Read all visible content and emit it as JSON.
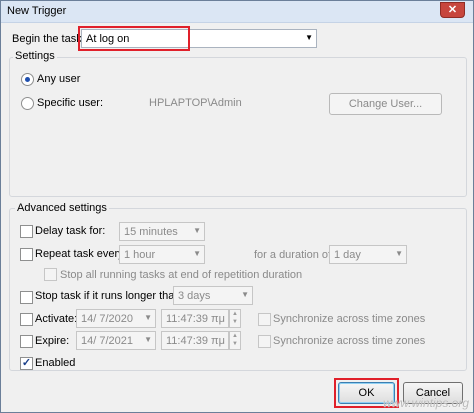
{
  "window": {
    "title": "New Trigger",
    "close_glyph": "✕"
  },
  "begin_task": {
    "label": "Begin the task:",
    "value": "At log on"
  },
  "settings": {
    "group_label": "Settings",
    "any_user_label": "Any user",
    "specific_user_label": "Specific user:",
    "user_value": "HPLAPTOP\\Admin",
    "change_user_label": "Change User..."
  },
  "advanced": {
    "group_label": "Advanced settings",
    "delay_label": "Delay task for:",
    "delay_value": "15 minutes",
    "repeat_label": "Repeat task every:",
    "repeat_value": "1 hour",
    "duration_label": "for a duration of:",
    "duration_value": "1 day",
    "stop_running_label": "Stop all running tasks at end of repetition duration",
    "stop_longer_label": "Stop task if it runs longer than:",
    "stop_longer_value": "3 days",
    "activate_label": "Activate:",
    "activate_date": "14/ 7/2020",
    "activate_time": "11:47:39 πμ",
    "expire_label": "Expire:",
    "expire_date": "14/ 7/2021",
    "expire_time": "11:47:39 πμ",
    "sync_label": "Synchronize across time zones",
    "enabled_label": "Enabled",
    "enabled_check": "✓"
  },
  "buttons": {
    "ok": "OK",
    "cancel": "Cancel"
  },
  "watermark": "www.wintips.org",
  "icons": {
    "dropdown": "▼",
    "spin_up": "▲",
    "spin_down": "▼"
  }
}
